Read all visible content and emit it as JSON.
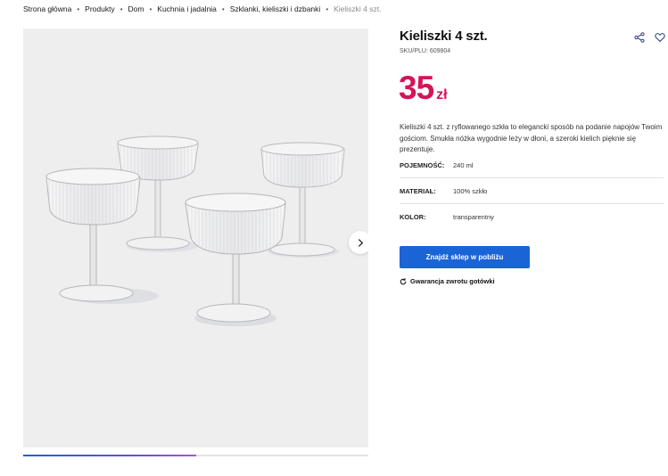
{
  "breadcrumb": {
    "items": [
      "Strona główna",
      "Produkty",
      "Dom",
      "Kuchnia i jadalnia",
      "Szklanki, kieliszki i dzbanki"
    ],
    "current": "Kieliszki 4 szt."
  },
  "product": {
    "title": "Kieliszki 4 szt.",
    "sku": "SKU/PLU: 609804",
    "price_value": "35",
    "price_currency": "zł",
    "description": "Kieliszki 4 szt. z ryflowanego szkła to elegancki sposób na podanie napojów Twoim gościom. Smukła nóżka wygodnie leży w dłoni, a szeroki kielich pięknie się prezentuje.",
    "specs": [
      {
        "label": "POJEMNOŚĆ:",
        "value": "240 ml"
      },
      {
        "label": "MATERIAŁ:",
        "value": "100% szkło"
      },
      {
        "label": "KOLOR:",
        "value": "transparentny"
      }
    ]
  },
  "actions": {
    "find_store": "Znajdź sklep w pobliżu",
    "guarantee": "Gwarancja zwrotu gotówki"
  },
  "gallery": {
    "progress": 0.5
  },
  "icons": {
    "share": "share-icon",
    "favorite": "heart-icon",
    "next": "chevron-right-icon",
    "refresh": "refresh-icon"
  },
  "colors": {
    "price": "#d4145a",
    "cta": "#1a64d6"
  }
}
